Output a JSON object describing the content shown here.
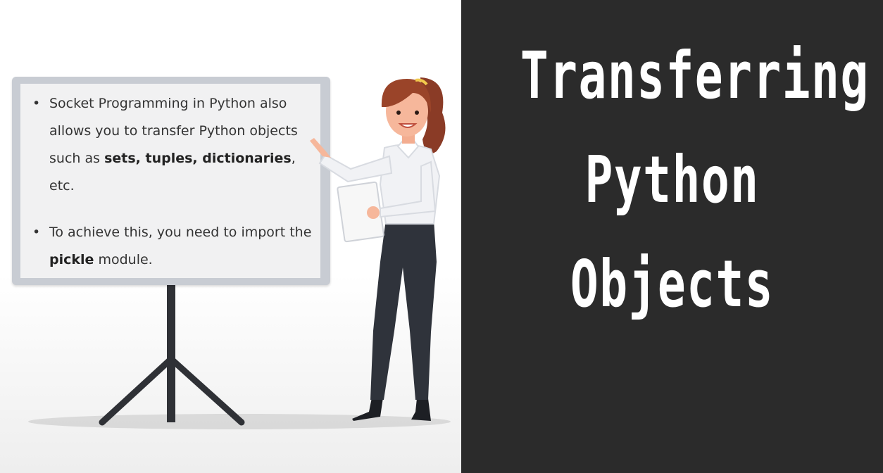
{
  "slide": {
    "bullets": [
      {
        "text_prefix": "Socket Programming in Python also allows you to transfer Python objects  such as ",
        "bold": "sets, tuples, dictionaries",
        "text_suffix": ", etc."
      },
      {
        "text_prefix": "To achieve this, you need to import the ",
        "bold": "pickle",
        "text_suffix": " module."
      }
    ]
  },
  "title": {
    "line1": "Transferring",
    "line2": "Python",
    "line3": "Objects"
  },
  "colors": {
    "right_background": "#2b2b2b",
    "title_text": "#ffffff",
    "board_frame": "#c8ccd3",
    "board_surface": "#f1f1f2"
  }
}
